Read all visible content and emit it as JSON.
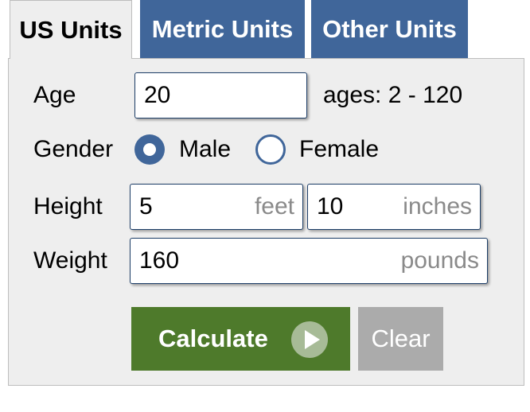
{
  "tabs": [
    {
      "label": "US Units",
      "active": true
    },
    {
      "label": "Metric Units",
      "active": false
    },
    {
      "label": "Other Units",
      "active": false
    }
  ],
  "form": {
    "age": {
      "label": "Age",
      "value": "20",
      "hint": "ages: 2 - 120"
    },
    "gender": {
      "label": "Gender",
      "options": [
        "Male",
        "Female"
      ],
      "selected": "Male"
    },
    "height": {
      "label": "Height",
      "feet_value": "5",
      "feet_unit": "feet",
      "inches_value": "10",
      "inches_unit": "inches"
    },
    "weight": {
      "label": "Weight",
      "value": "160",
      "unit": "pounds"
    }
  },
  "actions": {
    "calculate": "Calculate",
    "clear": "Clear"
  },
  "colors": {
    "tab_blue": "#40669a",
    "calculate_green": "#4e7a2b",
    "clear_gray": "#ababab",
    "panel_bg": "#eeeeee"
  }
}
